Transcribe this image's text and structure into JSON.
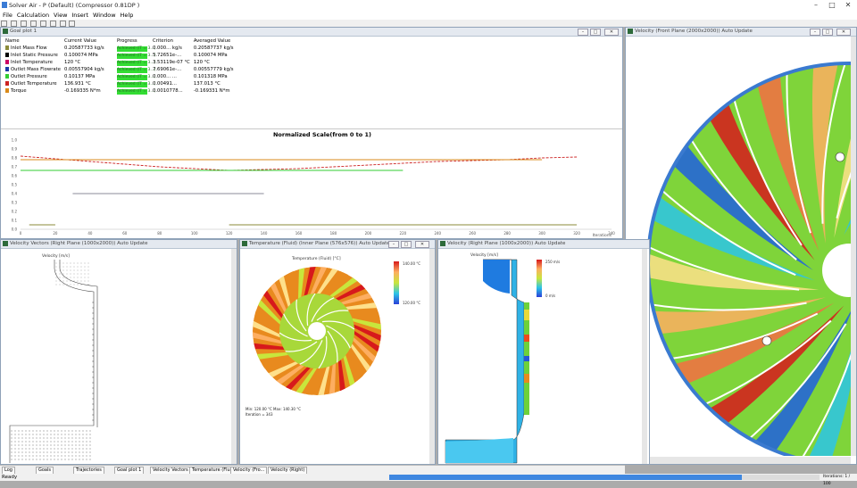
{
  "app": {
    "title": "Solver Air - P (Default) (Compressor 0.81DP )",
    "window_controls": [
      "–",
      "□",
      "✕"
    ]
  },
  "menu": [
    "File",
    "Calculation",
    "View",
    "Insert",
    "Window",
    "Help"
  ],
  "monitor": {
    "title": "Goal plot 1",
    "headers": [
      "Name",
      "Current Value",
      "Progress",
      "Criterion",
      "Averaged Value"
    ],
    "rows": [
      {
        "color": "#8b8b3a",
        "name": "Inlet Mass Flow",
        "value": "0.20587733 kg/s",
        "progress": "Achieved (IT = 3...)",
        "criterion": "0.000... kg/s",
        "avg": "0.20587737 kg/s"
      },
      {
        "color": "#000000",
        "name": "Inlet Static Pressure",
        "value": "0.100074 MPa",
        "progress": "Achieved (IT = 3...)",
        "criterion": "5.72651e-...",
        "avg": "0.100074 MPa"
      },
      {
        "color": "#cc0066",
        "name": "Inlet Temperature",
        "value": "120 °C",
        "progress": "Achieved (IT = 3...)",
        "criterion": "3.53119e-07 °C",
        "avg": "120 °C"
      },
      {
        "color": "#1a3aa8",
        "name": "Outlet Mass Flowrate",
        "value": "0.00557904 kg/s",
        "progress": "Achieved (IT = 3...)",
        "criterion": "7.69061e-...",
        "avg": "0.00557779 kg/s"
      },
      {
        "color": "#33cc33",
        "name": "Outlet Pressure",
        "value": "0.10137 MPa",
        "progress": "Achieved (IT = 3...)",
        "criterion": "0.000... ...",
        "avg": "0.101318 MPa"
      },
      {
        "color": "#cc2222",
        "name": "Outlet Temperature",
        "value": "136.931 °C",
        "progress": "Achieved (IT = 3...)",
        "criterion": "0.00491...",
        "avg": "137.013 °C"
      },
      {
        "color": "#d98a1a",
        "name": "Torque",
        "value": "-0.169335 N*m",
        "progress": "Achieved (IT = 3...)",
        "criterion": "0.0010778...",
        "avg": "-0.169331 N*m"
      }
    ]
  },
  "plot": {
    "title": "Normalized Scale(from 0 to 1)",
    "y_ticks": [
      "1.0",
      "0.9",
      "0.8",
      "0.7",
      "0.6",
      "0.5",
      "0.4",
      "0.3",
      "0.2",
      "0.1",
      "0.0"
    ],
    "x_ticks": [
      "0",
      "20",
      "40",
      "60",
      "80",
      "100",
      "120",
      "140",
      "160",
      "180",
      "200",
      "220",
      "240",
      "260",
      "280",
      "300",
      "320",
      "340"
    ],
    "x_label": "Iterations",
    "chart_data": {
      "type": "line",
      "title": "Normalized Scale(from 0 to 1)",
      "xlabel": "Iterations",
      "ylabel": "",
      "ylim": [
        0,
        1
      ],
      "xlim": [
        0,
        340
      ],
      "series": [
        {
          "color": "#cc2222",
          "x": [
            0,
            40,
            80,
            120,
            160,
            200,
            240,
            280,
            300,
            320
          ],
          "y": [
            0.82,
            0.76,
            0.7,
            0.66,
            0.68,
            0.72,
            0.76,
            0.78,
            0.8,
            0.81
          ]
        },
        {
          "color": "#d98a1a",
          "x": [
            0,
            300
          ],
          "y": [
            0.78,
            0.78
          ]
        },
        {
          "color": "#33cc33",
          "x": [
            0,
            220
          ],
          "y": [
            0.66,
            0.66
          ]
        },
        {
          "color": "#8b8b9a",
          "x": [
            30,
            140
          ],
          "y": [
            0.4,
            0.4
          ]
        },
        {
          "color": "#8b8b3a",
          "x": [
            120,
            320
          ],
          "y": [
            0.05,
            0.05
          ]
        },
        {
          "color": "#8b8b3a",
          "x": [
            5,
            20
          ],
          "y": [
            0.05,
            0.05
          ]
        }
      ]
    }
  },
  "views": {
    "vectors": {
      "title": "Velocity Vectors (Right Plane (1000x2000)) Auto Update",
      "legend_title": "Velocity [m/s]"
    },
    "temperature": {
      "title": "Temperature (Fluid) (Inner Plane (576x576)) Auto Update",
      "legend_title": "Temperature (Fluid) [°C]",
      "legend_max": "140.00 °C",
      "legend_min": "120.00 °C",
      "footer1": "Min: 120.00 °C  Max: 140.30 °C",
      "footer2": "Iteration = 343"
    },
    "velocity_right": {
      "title": "Velocity (Right Plane (1000x2000)) Auto Update",
      "legend_title": "Velocity [m/s]",
      "legend_max": "250 m/s",
      "legend_min": "0 m/s"
    },
    "velocity_front": {
      "title": "Velocity (Front Plane (2000x2000)) Auto Update"
    }
  },
  "tabs": [
    "Log",
    "Goals",
    "Trajectories",
    "Goal plot 1",
    "Velocity Vectors",
    "Temperature (Fluid)",
    "Velocity (Fro...",
    "Velocity (Right)"
  ],
  "status": {
    "left": "Ready",
    "right": "Iterations: 1 / 100",
    "progress": 0.82
  }
}
